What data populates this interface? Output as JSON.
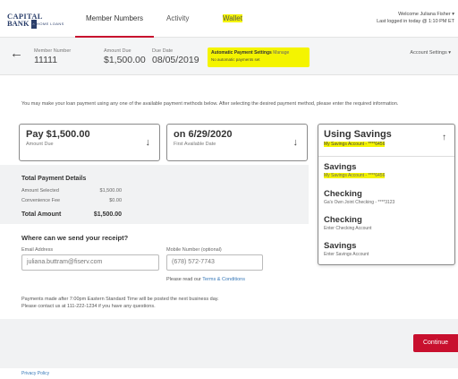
{
  "brand": {
    "line1": "CAPITAL",
    "line2": "BANK",
    "tagline": "HOME LOANS"
  },
  "nav": {
    "tabs": [
      {
        "label": "Member Numbers"
      },
      {
        "label": "Activity"
      },
      {
        "label": "Wallet"
      }
    ],
    "welcome": "Welcome Juliana Fisher",
    "last_login": "Last logged in today @ 1:10 PM ET"
  },
  "account_bar": {
    "member_number_label": "Member Number",
    "member_number": "11111",
    "amount_due_label": "Amount Due",
    "amount_due": "$1,500.00",
    "due_date_label": "Due Date",
    "due_date": "08/05/2019",
    "auto_pay_title": "Automatic Payment Settings",
    "auto_pay_manage": "Manage",
    "auto_pay_status": "No automatic payments set",
    "account_settings": "Account Settings"
  },
  "intro_text": "You may make your loan payment using any one of the available payment methods below. After selecting the desired payment method, please enter the required information.",
  "pay_amount": {
    "main": "Pay $1,500.00",
    "sub": "Amount Due"
  },
  "pay_date": {
    "main": "on 6/29/2020",
    "sub": "First Available Date"
  },
  "payment_method": {
    "selected_main": "Using Savings",
    "selected_sub": "My Savings Account - ****6456",
    "options": [
      {
        "main": "Savings",
        "sub": "My Savings Account - ****6456"
      },
      {
        "main": "Checking",
        "sub": "Ga's Own Joint Checking - ****3123"
      },
      {
        "main": "Checking",
        "sub": "Enter Checking Account"
      },
      {
        "main": "Savings",
        "sub": "Enter Savings Account"
      }
    ]
  },
  "totals": {
    "title": "Total Payment Details",
    "amount_selected_label": "Amount Selected",
    "amount_selected": "$1,500.00",
    "convenience_fee_label": "Convenience Fee",
    "convenience_fee": "$0.00",
    "total_label": "Total Amount",
    "total": "$1,500.00"
  },
  "receipt": {
    "title": "Where can we send your receipt?",
    "email_label": "Email Address",
    "email_value": "juliana.buttram@fiserv.com",
    "mobile_label": "Mobile Number (optional)",
    "mobile_value": "(678) 572-7743",
    "terms_prefix": "Please read our",
    "terms_link": "Terms & Conditions"
  },
  "notes": {
    "line1": "Payments made after 7:00pm Eastern Standard Time will be posted the next business day.",
    "line2": "Please contact us at 111-222-1234 if you have any questions."
  },
  "continue_label": "Continue",
  "privacy_policy": "Privacy Policy",
  "icons": {
    "back": "arrow-left-icon",
    "down": "arrow-down-icon",
    "up": "arrow-up-icon",
    "caret": "caret-down-icon"
  },
  "colors": {
    "accent": "#c8102e",
    "highlight": "#f4f400",
    "link": "#3778b8",
    "brand": "#2b3f6b"
  }
}
